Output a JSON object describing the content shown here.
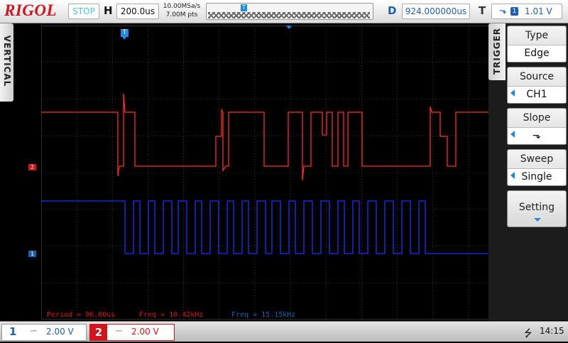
{
  "header": {
    "brand": "RIGOL",
    "run_state": "STOP",
    "horizontal_label": "H",
    "time_base": "200.0us",
    "sample_rate": "10.00MSa/s",
    "memory_depth": "7.00M pts",
    "memory_marker": "T",
    "delay_label": "D",
    "delay_value": "924.000000us",
    "trigger_label": "T",
    "trigger_slope_icon": "falling-edge-icon",
    "trigger_source_chip": "1",
    "trigger_level": "1.01 V"
  },
  "left_tab": {
    "label": "VERTICAL"
  },
  "trigger_menu": {
    "tab_label": "TRIGGER",
    "items": [
      {
        "title": "Type",
        "value": "Edge"
      },
      {
        "title": "Source",
        "value": "CH1"
      },
      {
        "title": "Slope",
        "value": "⬎"
      },
      {
        "title": "Sweep",
        "value": "Single"
      },
      {
        "title": "Setting",
        "value": ""
      }
    ]
  },
  "waveform": {
    "trigger_marker": "T",
    "ch2_marker": "2",
    "ch1_marker": "1",
    "ch2_color": "#ff2a2a",
    "ch1_color": "#1a33ff",
    "grid_color": "#5a5a5a"
  },
  "measurements": {
    "period": "Period = 96.00us",
    "freq_ch2": "Freq = 10.42kHz",
    "freq_ch1": "Freq = 15.15kHz"
  },
  "channels": {
    "ch1": {
      "number": "1",
      "coupling_icon": "dc-coupling-icon",
      "scale": "2.00 V"
    },
    "ch2": {
      "number": "2",
      "coupling_icon": "dc-coupling-icon",
      "scale": "2.00 V"
    }
  },
  "status": {
    "usb_icon": "usb-icon",
    "time": "14:15"
  }
}
